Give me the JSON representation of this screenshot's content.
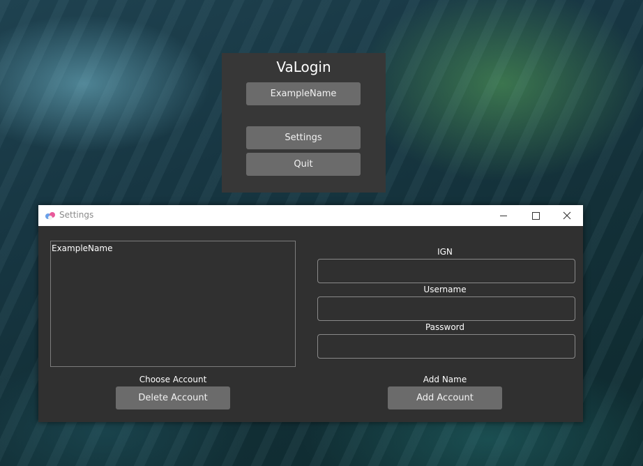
{
  "launcher": {
    "title": "VaLogin",
    "account_button": "ExampleName",
    "settings_button": "Settings",
    "quit_button": "Quit"
  },
  "settings_window": {
    "title": "Settings",
    "controls": {
      "minimize": "minimize-icon",
      "maximize": "maximize-icon",
      "close": "close-icon"
    },
    "accounts": [
      "ExampleName"
    ],
    "choose_account_label": "Choose Account",
    "delete_button": "Delete Account",
    "ign_label": "IGN",
    "ign_value": "",
    "username_label": "Username",
    "username_value": "",
    "password_label": "Password",
    "password_value": "",
    "add_name_label": "Add Name",
    "add_button": "Add Account"
  },
  "colors": {
    "panel": "#373737",
    "button": "#6b6b6b",
    "window_bg": "#303030"
  }
}
